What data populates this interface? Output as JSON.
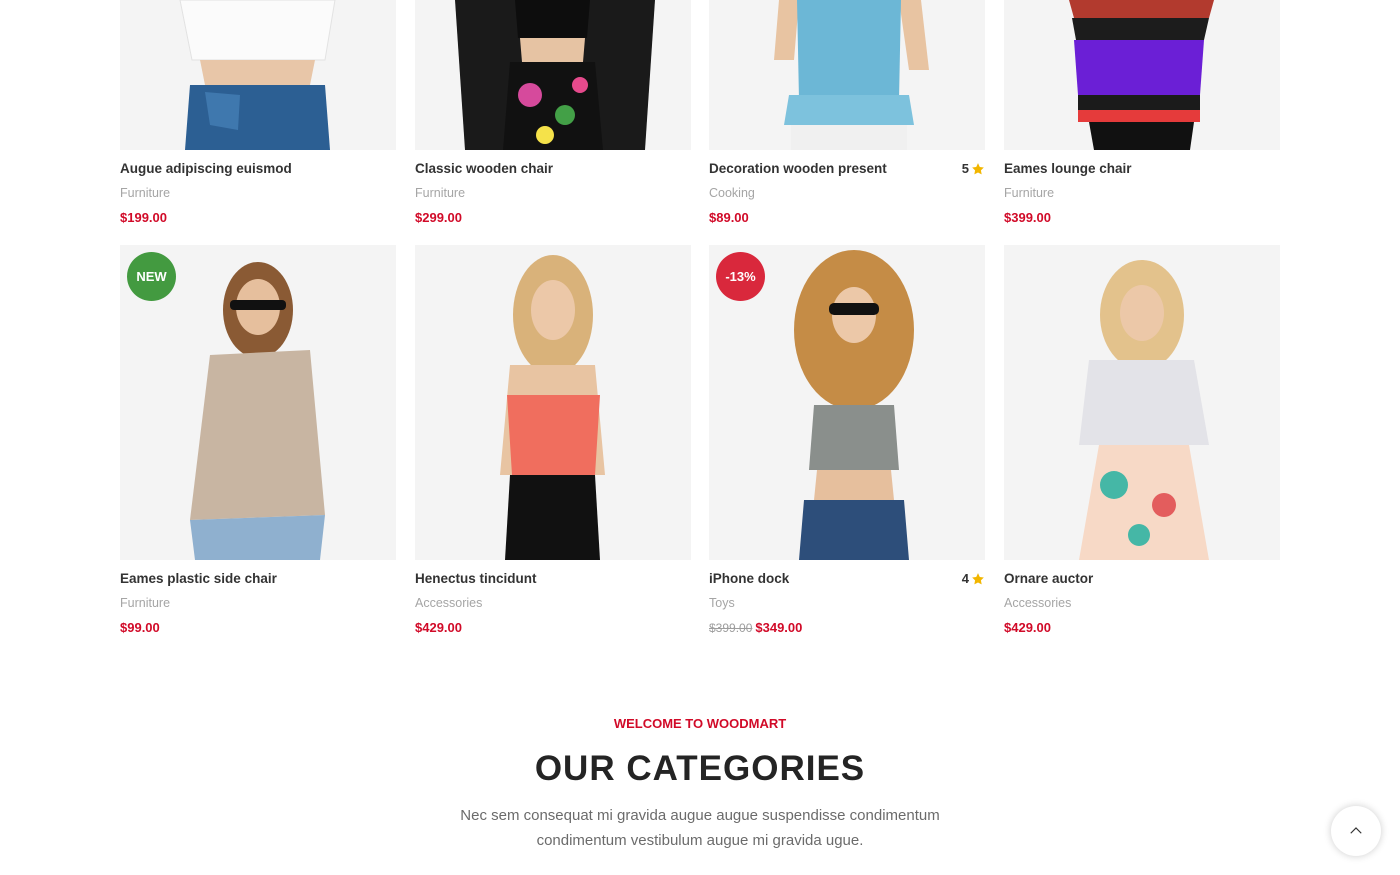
{
  "products": [
    {
      "title": "Augue adipiscing euismod",
      "category": "Furniture",
      "price": "$199.00",
      "rating": "",
      "badge": "",
      "old_price": ""
    },
    {
      "title": "Classic wooden chair",
      "category": "Furniture",
      "price": "$299.00",
      "rating": "",
      "badge": "",
      "old_price": ""
    },
    {
      "title": "Decoration wooden present",
      "category": "Cooking",
      "price": "$89.00",
      "rating": "5",
      "badge": "",
      "old_price": ""
    },
    {
      "title": "Eames lounge chair",
      "category": "Furniture",
      "price": "$399.00",
      "rating": "",
      "badge": "",
      "old_price": ""
    },
    {
      "title": "Eames plastic side chair",
      "category": "Furniture",
      "price": "$99.00",
      "rating": "",
      "badge": "NEW",
      "old_price": ""
    },
    {
      "title": "Henectus tincidunt",
      "category": "Accessories",
      "price": "$429.00",
      "rating": "",
      "badge": "",
      "old_price": ""
    },
    {
      "title": "iPhone dock",
      "category": "Toys",
      "price": "$349.00",
      "rating": "4",
      "badge": "-13%",
      "old_price": "$399.00"
    },
    {
      "title": "Ornare auctor",
      "category": "Accessories",
      "price": "$429.00",
      "rating": "",
      "badge": "",
      "old_price": ""
    }
  ],
  "section": {
    "eyebrow": "WELCOME TO WOODMART",
    "heading": "OUR CATEGORIES",
    "subtitle": "Nec sem consequat mi gravida augue augue suspendisse condimentum condimentum vestibulum augue mi gravida ugue."
  },
  "colors": {
    "accent_red": "#d10a28",
    "badge_new": "#439a40",
    "badge_sale": "#d9283c",
    "star": "#f2b600"
  },
  "icons": {
    "rating": "star-icon",
    "scroll_top": "chevron-up-icon"
  }
}
